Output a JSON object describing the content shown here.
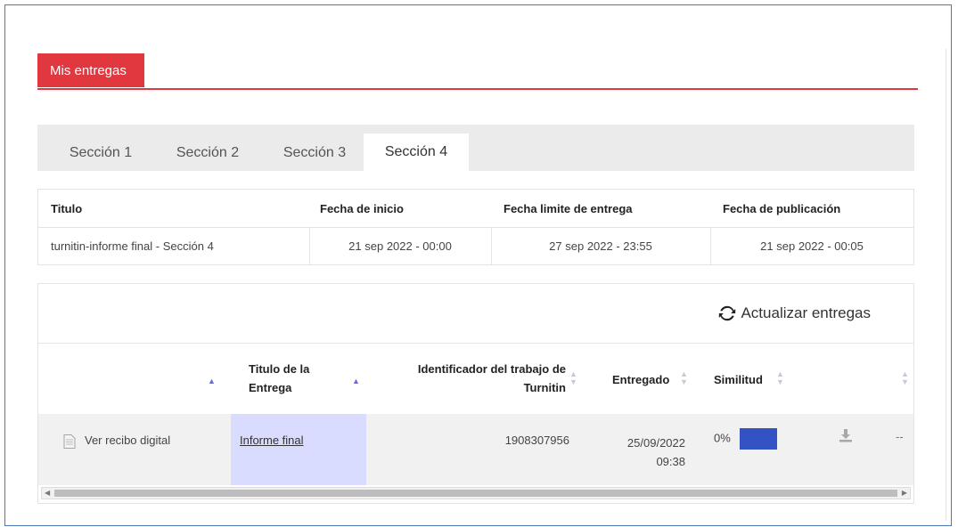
{
  "main_tab": {
    "label": "Mis entregas",
    "accent": "#e0383e"
  },
  "sections": {
    "tabs": [
      "Sección 1",
      "Sección 2",
      "Sección 3",
      "Sección 4"
    ],
    "active": "Sección 4"
  },
  "info": {
    "headers": {
      "title": "Titulo",
      "start": "Fecha de inicio",
      "due": "Fecha limite de entrega",
      "publish": "Fecha de publicación"
    },
    "row": {
      "title": "turnitin-informe final - Sección 4",
      "start": "21 sep 2022 - 00:00",
      "due": "27 sep 2022 - 23:55",
      "publish": "21 sep 2022 - 00:05"
    }
  },
  "refresh": {
    "label": "Actualizar entregas",
    "icon": "refresh-icon"
  },
  "grid": {
    "headers": {
      "title_1": "Titulo de la",
      "title_2": "Entrega",
      "id_1": "Identificador del trabajo de",
      "id_2": "Turnitin",
      "submitted": "Entregado",
      "similarity": "Similitud"
    },
    "row": {
      "receipt": "Ver recibo digital",
      "title": "Informe final",
      "paper_id": "1908307956",
      "date": "25/09/2022",
      "time": "09:38",
      "similarity": "0%",
      "similarity_color": "#3352c4",
      "extra": "--"
    }
  }
}
